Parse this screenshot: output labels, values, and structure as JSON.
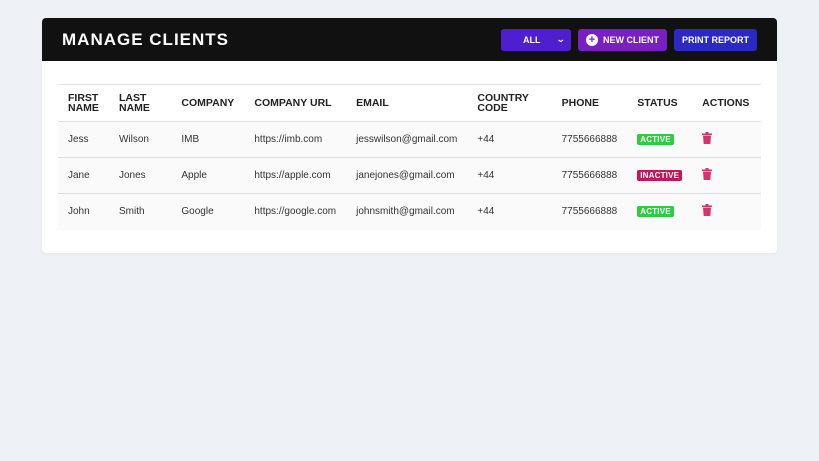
{
  "header": {
    "title": "MANAGE CLIENTS",
    "filter_value": "ALL",
    "new_client_label": "NEW CLIENT",
    "print_label": "PRINT REPORT"
  },
  "table": {
    "columns": [
      "FIRST NAME",
      "LAST NAME",
      "COMPANY",
      "COMPANY URL",
      "EMAIL",
      "COUNTRY CODE",
      "PHONE",
      "STATUS",
      "ACTIONS"
    ],
    "rows": [
      {
        "first": "Jess",
        "last": "Wilson",
        "company": "IMB",
        "url": "https://imb.com",
        "email": "jesswilson@gmail.com",
        "code": "+44",
        "phone": "7755666888",
        "status": "ACTIVE"
      },
      {
        "first": "Jane",
        "last": "Jones",
        "company": "Apple",
        "url": "https://apple.com",
        "email": "janejones@gmail.com",
        "code": "+44",
        "phone": "7755666888",
        "status": "INACTIVE"
      },
      {
        "first": "John",
        "last": "Smith",
        "company": "Google",
        "url": "https://google.com",
        "email": "johnsmith@gmail.com",
        "code": "+44",
        "phone": "7755666888",
        "status": "ACTIVE"
      }
    ]
  },
  "colors": {
    "header_bg": "#111111",
    "filter_bg": "#4f1ed0",
    "new_client_bg": "#7a1fc2",
    "print_bg": "#2b28c4",
    "active": "#2ecc40",
    "inactive": "#c2185b",
    "trash": "#d6336c"
  },
  "icons": {
    "filter": "chevron-down-icon",
    "new_client": "plus-circle-icon",
    "delete": "trash-icon"
  }
}
